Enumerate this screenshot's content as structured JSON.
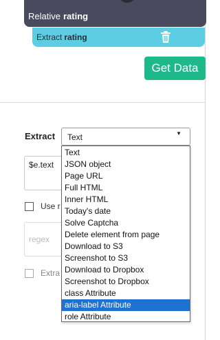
{
  "relative_rule": {
    "prefix": "Relative",
    "field": "rating"
  },
  "extract_rule": {
    "prefix": "Extract",
    "field": "rating",
    "delete_icon": "trash-icon"
  },
  "get_data_button": "Get Data",
  "form": {
    "extract_label": "Extract",
    "selected_type": "Text",
    "expression_value": "$e.text",
    "use_regex_label_partial": "Use r",
    "regex_placeholder": "regex",
    "extract_other_label_partial": "Extra"
  },
  "dropdown": {
    "options": [
      "Text",
      "JSON object",
      "Page URL",
      "Full HTML",
      "Inner HTML",
      "Today's date",
      "Solve Captcha",
      "Delete element from page",
      "Download to S3",
      "Screenshot to S3",
      "Download to Dropbox",
      "Screenshot to Dropbox",
      "class Attribute",
      "aria-label Attribute",
      "role Attribute"
    ],
    "highlighted": "aria-label Attribute"
  },
  "colors": {
    "relative_pill": "#4a4a5e",
    "extract_pill": "#5ccde2",
    "get_data": "#1eb98a",
    "highlight": "#1e73d2"
  }
}
